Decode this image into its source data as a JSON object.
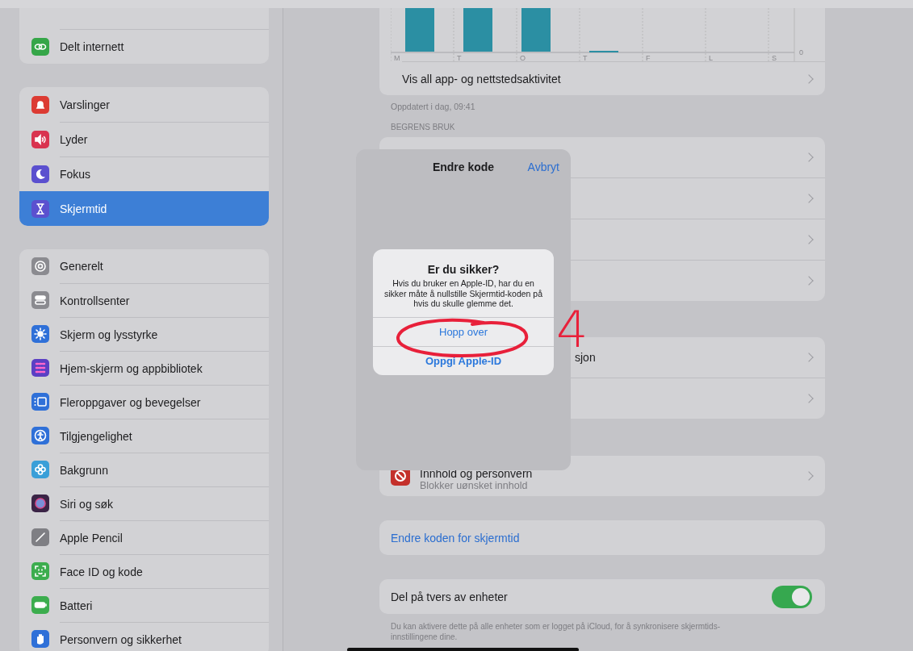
{
  "sidebar": {
    "groups": [
      {
        "items": [
          {
            "label": "Delt internett",
            "color": "#35a648",
            "selected": false
          }
        ]
      },
      {
        "items": [
          {
            "label": "Varslinger",
            "color": "#dc3b33",
            "selected": false
          },
          {
            "label": "Lyder",
            "color": "#d9334f",
            "selected": false
          },
          {
            "label": "Fokus",
            "color": "#5b50cf",
            "selected": false
          },
          {
            "label": "Skjermtid",
            "color": "#5b50cf",
            "selected": true
          }
        ]
      },
      {
        "items": [
          {
            "label": "Generelt",
            "color": "#8b8b90",
            "selected": false
          },
          {
            "label": "Kontrollsenter",
            "color": "#8b8b90",
            "selected": false
          },
          {
            "label": "Skjerm og lysstyrke",
            "color": "#2f70d8",
            "selected": false
          },
          {
            "label": "Hjem-skjerm og appbibliotek",
            "color": "#5b3fc4",
            "selected": false
          },
          {
            "label": "Fleroppgaver og bevegelser",
            "color": "#2f70d8",
            "selected": false
          },
          {
            "label": "Tilgjengelighet",
            "color": "#2f70d8",
            "selected": false
          },
          {
            "label": "Bakgrunn",
            "color": "#3a9fd8",
            "selected": false
          },
          {
            "label": "Siri og søk",
            "color": "#3b2446",
            "selected": false
          },
          {
            "label": "Apple Pencil",
            "color": "#7f7f84",
            "selected": false
          },
          {
            "label": "Face ID og kode",
            "color": "#3cad4e",
            "selected": false
          },
          {
            "label": "Batteri",
            "color": "#3cad4e",
            "selected": false
          },
          {
            "label": "Personvern og sikkerhet",
            "color": "#2f70d8",
            "selected": false
          }
        ]
      }
    ]
  },
  "detail": {
    "chart": {
      "days": [
        "M",
        "T",
        "O",
        "T",
        "F",
        "L",
        "S"
      ],
      "axis_label": "0"
    },
    "activity_row": {
      "label": "Vis all app- og nettstedsaktivitet"
    },
    "updated_note": "Oppdatert i dag, 09:41",
    "limit_header": "BEGRENS BRUK",
    "limit_rows": [
      {
        "chevron": true
      },
      {
        "chevron": true
      },
      {
        "chevron": true
      },
      {
        "chevron": true
      }
    ],
    "comm_rows": [
      {
        "label": "sjon",
        "chevron": true
      },
      {
        "chevron": true
      }
    ],
    "content_row": {
      "title": "Innhold og personvern",
      "subtitle": "Blokker uønsket innhold"
    },
    "change_code_link": "Endre koden for skjermtid",
    "share_row": {
      "label": "Del på tvers av enheter",
      "on": true
    },
    "share_note": "Du kan aktivere dette på alle enheter som er logget på iCloud, for å synkronisere skjermtids-innstillingene dine."
  },
  "sheet": {
    "title": "Endre kode",
    "cancel": "Avbryt"
  },
  "alert": {
    "title": "Er du sikker?",
    "message": "Hvis du bruker en Apple-ID, har du en sikker måte å nullstille Skjermtid-koden på hvis du skulle glemme det.",
    "buttons": [
      {
        "label": "Hopp over",
        "kind": "plain"
      },
      {
        "label": "Oppgi Apple-ID",
        "kind": "bold"
      }
    ]
  },
  "annotation": {
    "label": "4"
  }
}
